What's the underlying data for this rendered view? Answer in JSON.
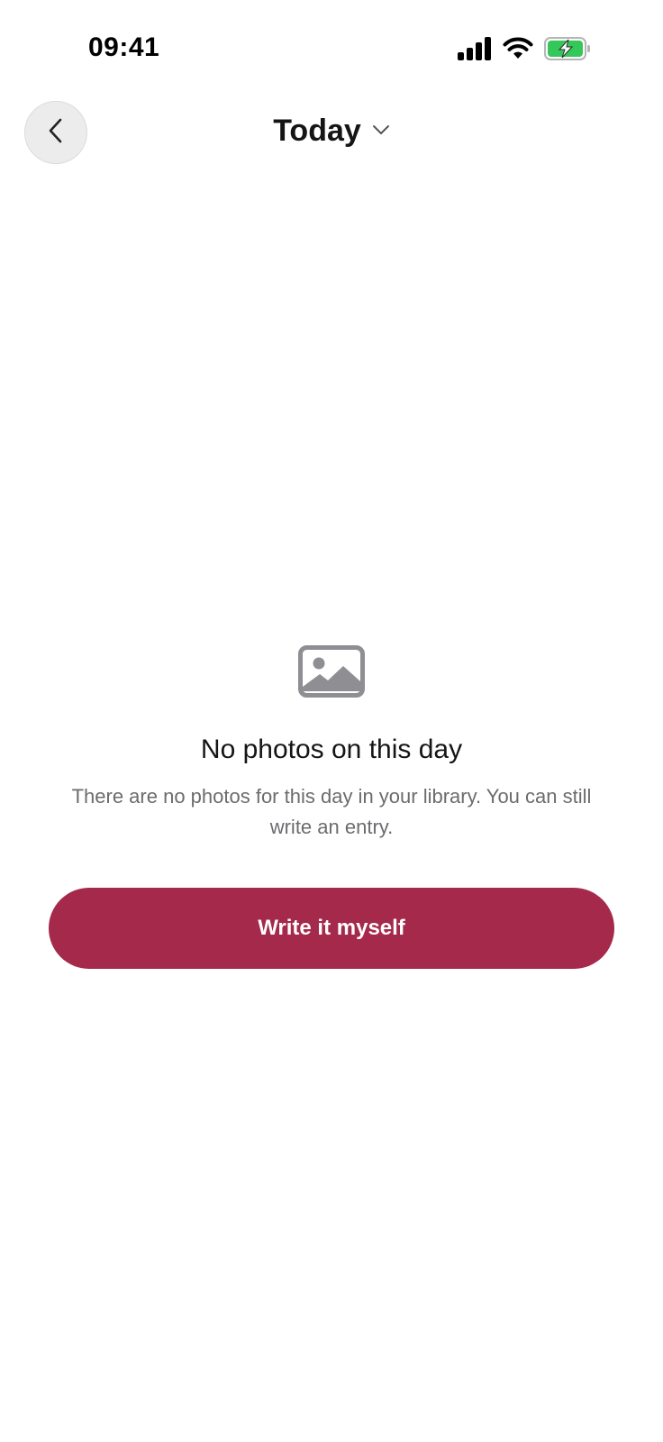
{
  "status_bar": {
    "time": "09:41",
    "icons": [
      "cellular-signal-icon",
      "wifi-icon",
      "battery-charging-icon"
    ]
  },
  "header": {
    "back_icon": "chevron-left-icon",
    "title": "Today",
    "title_dropdown_icon": "chevron-down-icon"
  },
  "empty_state": {
    "icon": "photo-icon",
    "title": "No photos on this day",
    "description": "There are no photos for this day in your library. You can still write an entry."
  },
  "primary_action": {
    "label": "Write it myself"
  },
  "colors": {
    "accent": "#a5294b",
    "battery_fill": "#34c759",
    "icon_gray": "#8e8e93",
    "secondary_text": "#6c6c70"
  }
}
